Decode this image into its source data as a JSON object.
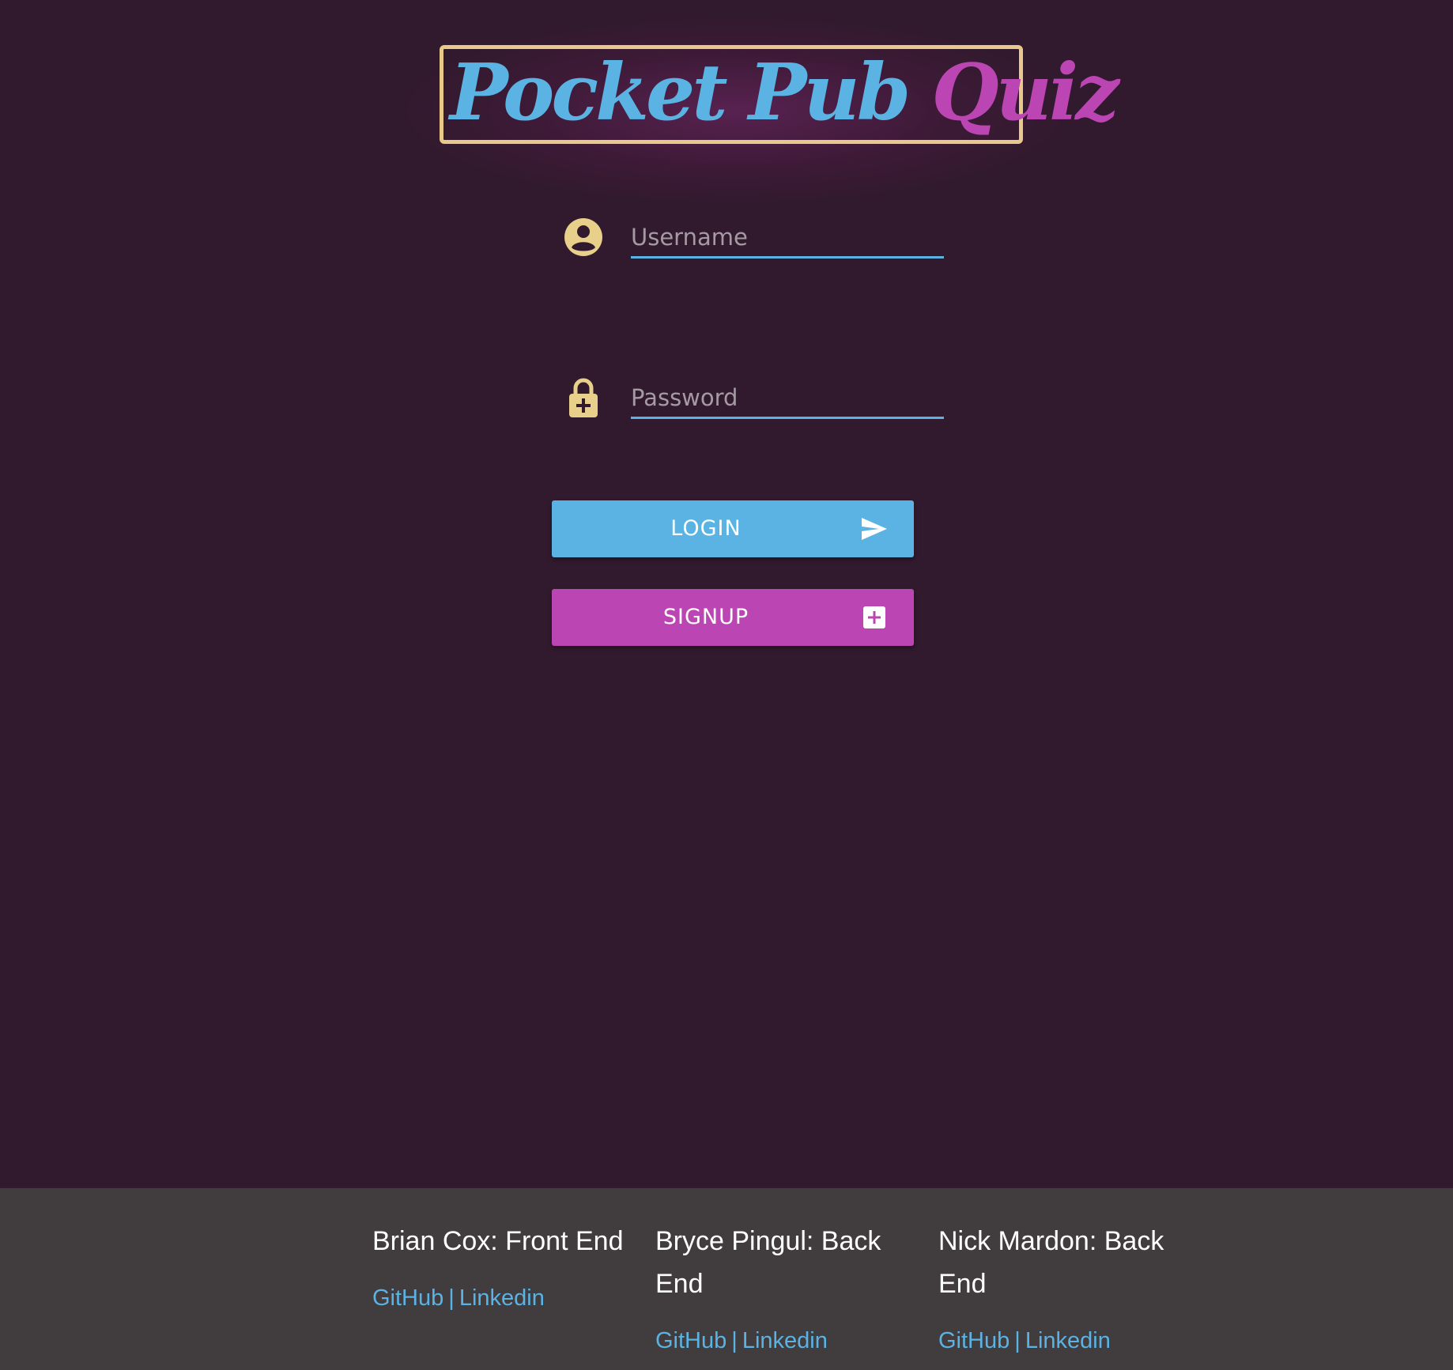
{
  "logo": {
    "word1": "Pocket",
    "word2": "Pub",
    "word3": "Quiz"
  },
  "form": {
    "username_placeholder": "Username",
    "password_placeholder": "Password",
    "username_icon": "account-circle-icon",
    "password_icon": "lock-plus-icon"
  },
  "buttons": {
    "login_label": "LOGIN",
    "login_icon": "send-icon",
    "signup_label": "SIGNUP",
    "signup_icon": "plus-box-icon"
  },
  "footer": {
    "members": [
      {
        "name": "Brian Cox: Front End",
        "github": "GitHub",
        "separator": "|",
        "linkedin": "Linkedin"
      },
      {
        "name": "Bryce Pingul: Back End",
        "github": "GitHub",
        "separator": "|",
        "linkedin": "Linkedin"
      },
      {
        "name": "Nick Mardon: Back End",
        "github": "GitHub",
        "separator": "|",
        "linkedin": "Linkedin"
      }
    ]
  },
  "colors": {
    "background": "#311a2d",
    "accent_blue": "#5ab3e3",
    "accent_pink": "#bb45b3",
    "logo_border": "#e8c98a",
    "icon_gold": "#e8cf8a",
    "footer_bg": "#413c3e"
  }
}
